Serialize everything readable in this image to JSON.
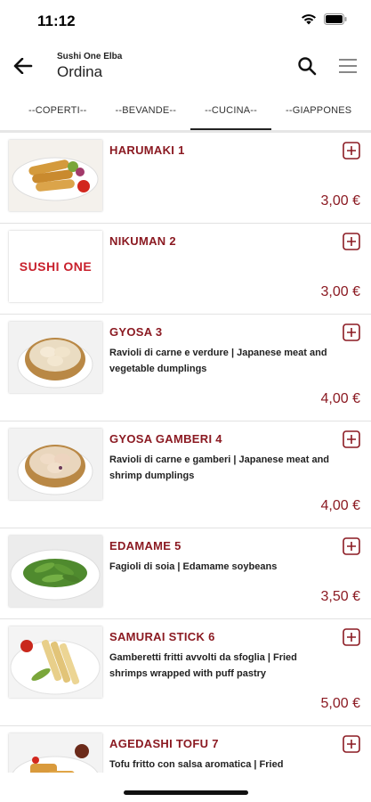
{
  "status_bar": {
    "time": "11:12"
  },
  "header": {
    "subtitle": "Sushi One Elba",
    "title": "Ordina"
  },
  "tabs": [
    {
      "label": "--COPERTI--",
      "active": false
    },
    {
      "label": "--BEVANDE--",
      "active": false
    },
    {
      "label": "--CUCINA--",
      "active": true
    },
    {
      "label": "--GIAPPONES",
      "active": false
    }
  ],
  "items": [
    {
      "name": "HARUMAKI 1",
      "desc": "",
      "price": "3,00 €",
      "image": "spring-rolls-image"
    },
    {
      "name": "NIKUMAN 2",
      "desc": "",
      "price": "3,00 €",
      "image": "sushi-one-logo",
      "logo_text": "SUSHI ONE"
    },
    {
      "name": "GYOSA 3",
      "desc": "Ravioli di carne e verdure | Japanese meat and vegetable dumplings",
      "price": "4,00 €",
      "image": "dumplings-image"
    },
    {
      "name": "GYOSA GAMBERI 4",
      "desc": "Ravioli di carne e gamberi | Japanese meat and shrimp dumplings",
      "price": "4,00 €",
      "image": "shrimp-dumplings-image"
    },
    {
      "name": "EDAMAME 5",
      "desc": "Fagioli di soia | Edamame soybeans",
      "price": "3,50 €",
      "image": "edamame-image"
    },
    {
      "name": "SAMURAI STICK 6",
      "desc": "Gamberetti fritti avvolti da sfoglia | Fried shrimps wrapped with puff pastry",
      "price": "5,00 €",
      "image": "samurai-stick-image"
    },
    {
      "name": "AGEDASHI TOFU 7",
      "desc": "Tofu fritto con salsa aromatica | Fried",
      "price": "",
      "image": "agedashi-tofu-image"
    }
  ],
  "colors": {
    "accent": "#8b1a22"
  }
}
